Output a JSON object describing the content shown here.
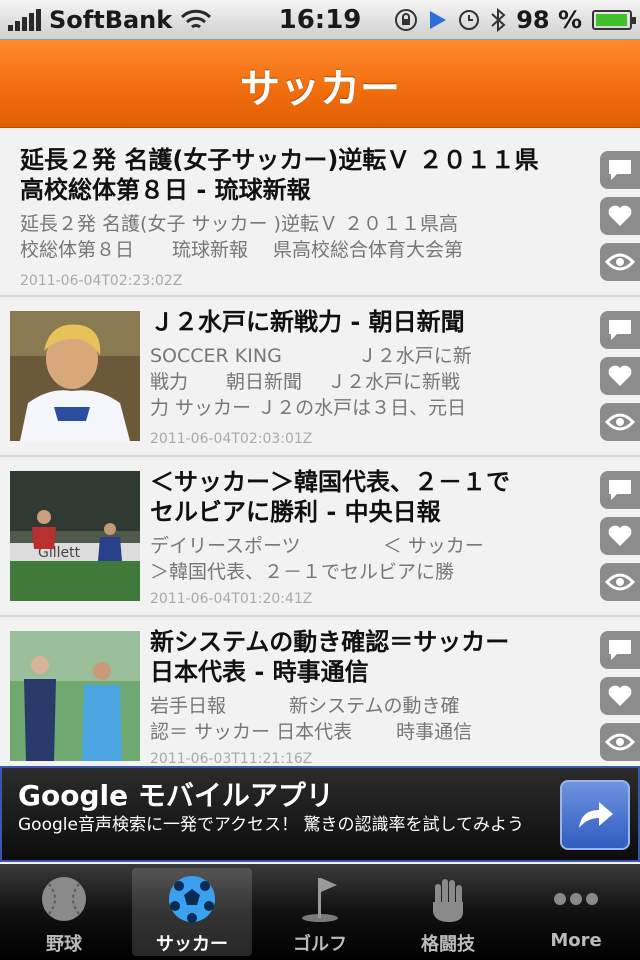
{
  "status_bar": {
    "carrier": "SoftBank",
    "time": "16:19",
    "battery": "98 %",
    "battery_level": 0.98
  },
  "nav": {
    "title": "サッカー"
  },
  "items": [
    {
      "title_lines": [
        "延長２発 名護(女子サッカー)逆転Ｖ ２０１１県",
        "高校総体第８日 - 琉球新報"
      ],
      "desc_lines": [
        "延長２発 名護(女子 サッカー )逆転Ｖ ２０１１県高",
        "校総体第８日　　琉球新報　 県高校総合体育大会第"
      ],
      "date": "2011-06-04T02:23:02Z"
    },
    {
      "title_lines": [
        "Ｊ２水戸に新戦力 - 朝日新聞"
      ],
      "desc_lines": [
        "SOCCER KING　　　　Ｊ２水戸に新",
        "戦力　　朝日新聞　 Ｊ２水戸に新戦",
        "力 サッカー Ｊ２の水戸は３日、元日"
      ],
      "date": "2011-06-04T02:03:01Z"
    },
    {
      "title_lines": [
        "＜サッカー＞韓国代表、２－１で",
        "セルビアに勝利 - 中央日報"
      ],
      "desc_lines": [
        "デイリースポーツ　　　　 ＜ サッカー",
        "＞韓国代表、２－１でセルビアに勝"
      ],
      "date": "2011-06-04T01:20:41Z"
    },
    {
      "title_lines": [
        "新システムの動き確認＝サッカー",
        "日本代表 - 時事通信"
      ],
      "desc_lines": [
        "岩手日報　　　 新システムの動き確",
        "認＝ サッカー 日本代表　　 時事通信"
      ],
      "date": "2011-06-03T11:21:16Z"
    }
  ],
  "ad": {
    "title": "Google モバイルアプリ",
    "subtitle": "Google音声検索に一発でアクセス！ 驚きの認識率を試してみよう"
  },
  "tabs": [
    {
      "label": "野球",
      "icon": "baseball-icon"
    },
    {
      "label": "サッカー",
      "icon": "soccer-ball-icon",
      "active": true
    },
    {
      "label": "ゴルフ",
      "icon": "golf-flag-icon"
    },
    {
      "label": "格闘技",
      "icon": "hand-icon"
    },
    {
      "label": "More",
      "icon": "more-dots-icon"
    }
  ],
  "colors": {
    "nav_orange": "#f06c0c",
    "action_gray": "#8c8c8c",
    "ad_button_blue": "#2f5cc0"
  }
}
